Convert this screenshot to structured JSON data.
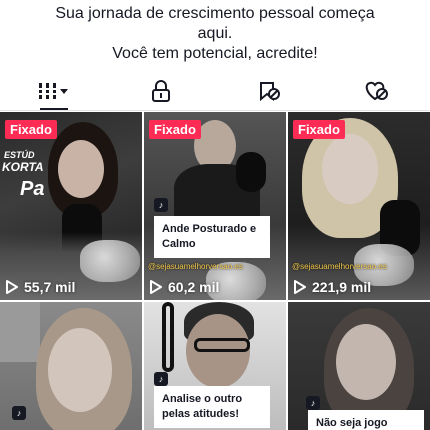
{
  "bio": {
    "line1": "Sua jornada de crescimento pessoal começa",
    "line2": "aqui.",
    "line3": "Você tem potencial, acredite!"
  },
  "tabs": [
    {
      "icon": "grid-icon",
      "active": true
    },
    {
      "icon": "lock-icon",
      "active": false
    },
    {
      "icon": "bookmark-hidden-icon",
      "active": false
    },
    {
      "icon": "heart-hidden-icon",
      "active": false
    }
  ],
  "videos": [
    {
      "pinned": "Fixado",
      "views": "55,7 mil",
      "side_text": [
        "ESTÚD",
        "KORTA",
        "Pa"
      ]
    },
    {
      "pinned": "Fixado",
      "views": "60,2 mil",
      "caption": "Ande Posturado e Calmo",
      "watermark": "@sejasuamelhorversao.es"
    },
    {
      "pinned": "Fixado",
      "views": "221,9 mil",
      "watermark": "@sejasuamelhorversao.es"
    },
    {
      "caption": ""
    },
    {
      "caption": "Analise o outro pelas atitudes!"
    },
    {
      "caption": "Não seja jogo"
    }
  ]
}
